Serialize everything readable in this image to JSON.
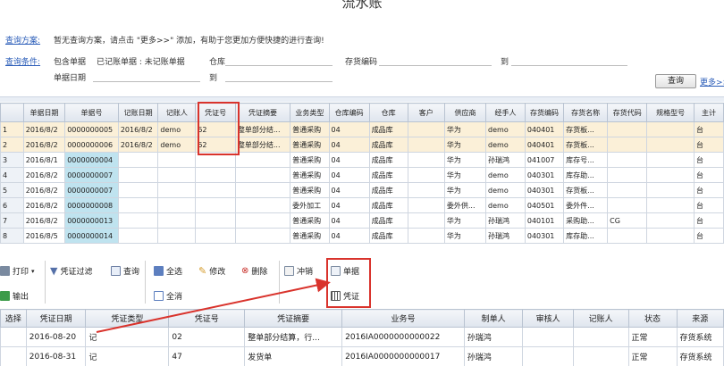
{
  "title": "流水账",
  "query": {
    "scheme_label": "查询方案:",
    "scheme_text": "暂无查询方案，请点击 \"更多>>\" 添加，有助于您更加方便快捷的进行查询!",
    "condition_label": "查询条件:",
    "opt_include": "包含单据",
    "opt_posted": "已记账单据 : 未记账单据",
    "warehouse_label": "仓库",
    "inv_code_label": "存货编码",
    "to_label": "到",
    "bill_date_label": "单据日期",
    "date_to_label": "到",
    "query_button": "查询",
    "more_link": "更多>>"
  },
  "grid": {
    "columns": [
      "单据日期",
      "单据号",
      "记账日期",
      "记账人",
      "凭证号",
      "凭证摘要",
      "业务类型",
      "仓库编码",
      "仓库",
      "客户",
      "供应商",
      "经手人",
      "存货编码",
      "存货名称",
      "存货代码",
      "规格型号",
      "主计"
    ],
    "rows": [
      {
        "no": "1",
        "cells": [
          "2016/8/2",
          "0000000005",
          "2016/8/2",
          "demo",
          "62",
          "整单部分结...",
          "普通采购",
          "04",
          "成品库",
          "",
          "华为",
          "demo",
          "040401",
          "存货板...",
          "",
          "",
          "台"
        ]
      },
      {
        "no": "2",
        "cells": [
          "2016/8/2",
          "0000000006",
          "2016/8/2",
          "demo",
          "62",
          "整单部分结...",
          "普通采购",
          "04",
          "成品库",
          "",
          "华为",
          "demo",
          "040401",
          "存货板...",
          "",
          "",
          "台"
        ]
      },
      {
        "no": "3",
        "cells": [
          "2016/8/1",
          "0000000004",
          "",
          "",
          "",
          "",
          "普通采购",
          "04",
          "成品库",
          "",
          "华为",
          "孙瑞鸿",
          "041007",
          "库存号...",
          "",
          "",
          "台"
        ]
      },
      {
        "no": "4",
        "cells": [
          "2016/8/2",
          "0000000007",
          "",
          "",
          "",
          "",
          "普通采购",
          "04",
          "成品库",
          "",
          "华为",
          "demo",
          "040301",
          "库存助...",
          "",
          "",
          "台"
        ]
      },
      {
        "no": "5",
        "cells": [
          "2016/8/2",
          "0000000007",
          "",
          "",
          "",
          "",
          "普通采购",
          "04",
          "成品库",
          "",
          "华为",
          "demo",
          "040301",
          "存货板...",
          "",
          "",
          "台"
        ]
      },
      {
        "no": "6",
        "cells": [
          "2016/8/2",
          "0000000008",
          "",
          "",
          "",
          "",
          "委外加工",
          "04",
          "成品库",
          "",
          "委外供...",
          "demo",
          "040501",
          "委外件...",
          "",
          "",
          "台"
        ]
      },
      {
        "no": "7",
        "cells": [
          "2016/8/2",
          "0000000013",
          "",
          "",
          "",
          "",
          "普通采购",
          "04",
          "成品库",
          "",
          "华为",
          "孙瑞鸿",
          "040101",
          "采购助...",
          "CG",
          "",
          "台"
        ]
      },
      {
        "no": "8",
        "cells": [
          "2016/8/5",
          "0000000014",
          "",
          "",
          "",
          "",
          "普通采购",
          "04",
          "成品库",
          "",
          "华为",
          "孙瑞鸿",
          "040301",
          "库存助...",
          "",
          "",
          "台"
        ]
      }
    ]
  },
  "toolbar": {
    "print": "打印",
    "export": "输出",
    "voucher_filter": "凭证过滤",
    "query": "查询",
    "select_all": "全选",
    "deselect_all": "全消",
    "edit": "修改",
    "delete": "删除",
    "reverse": "冲销",
    "bill": "单据",
    "voucher": "凭证"
  },
  "grid2": {
    "columns": [
      "选择",
      "凭证日期",
      "凭证类型",
      "凭证号",
      "凭证摘要",
      "业务号",
      "制单人",
      "审核人",
      "记账人",
      "状态",
      "来源"
    ],
    "rows": [
      [
        "",
        "2016-08-20",
        "记",
        "02",
        "整单部分结算，行...",
        "2016IA0000000000022",
        "孙瑞鸿",
        "",
        "",
        "正常",
        "存货系统"
      ],
      [
        "",
        "2016-08-31",
        "记",
        "47",
        "发货单",
        "2016IA0000000000017",
        "孙瑞鸿",
        "",
        "",
        "正常",
        "存货系统"
      ]
    ]
  },
  "colors": {
    "highlight_box": "#d9332c",
    "link": "#2a5cb8",
    "bill_cell": "#bfe3ef"
  }
}
